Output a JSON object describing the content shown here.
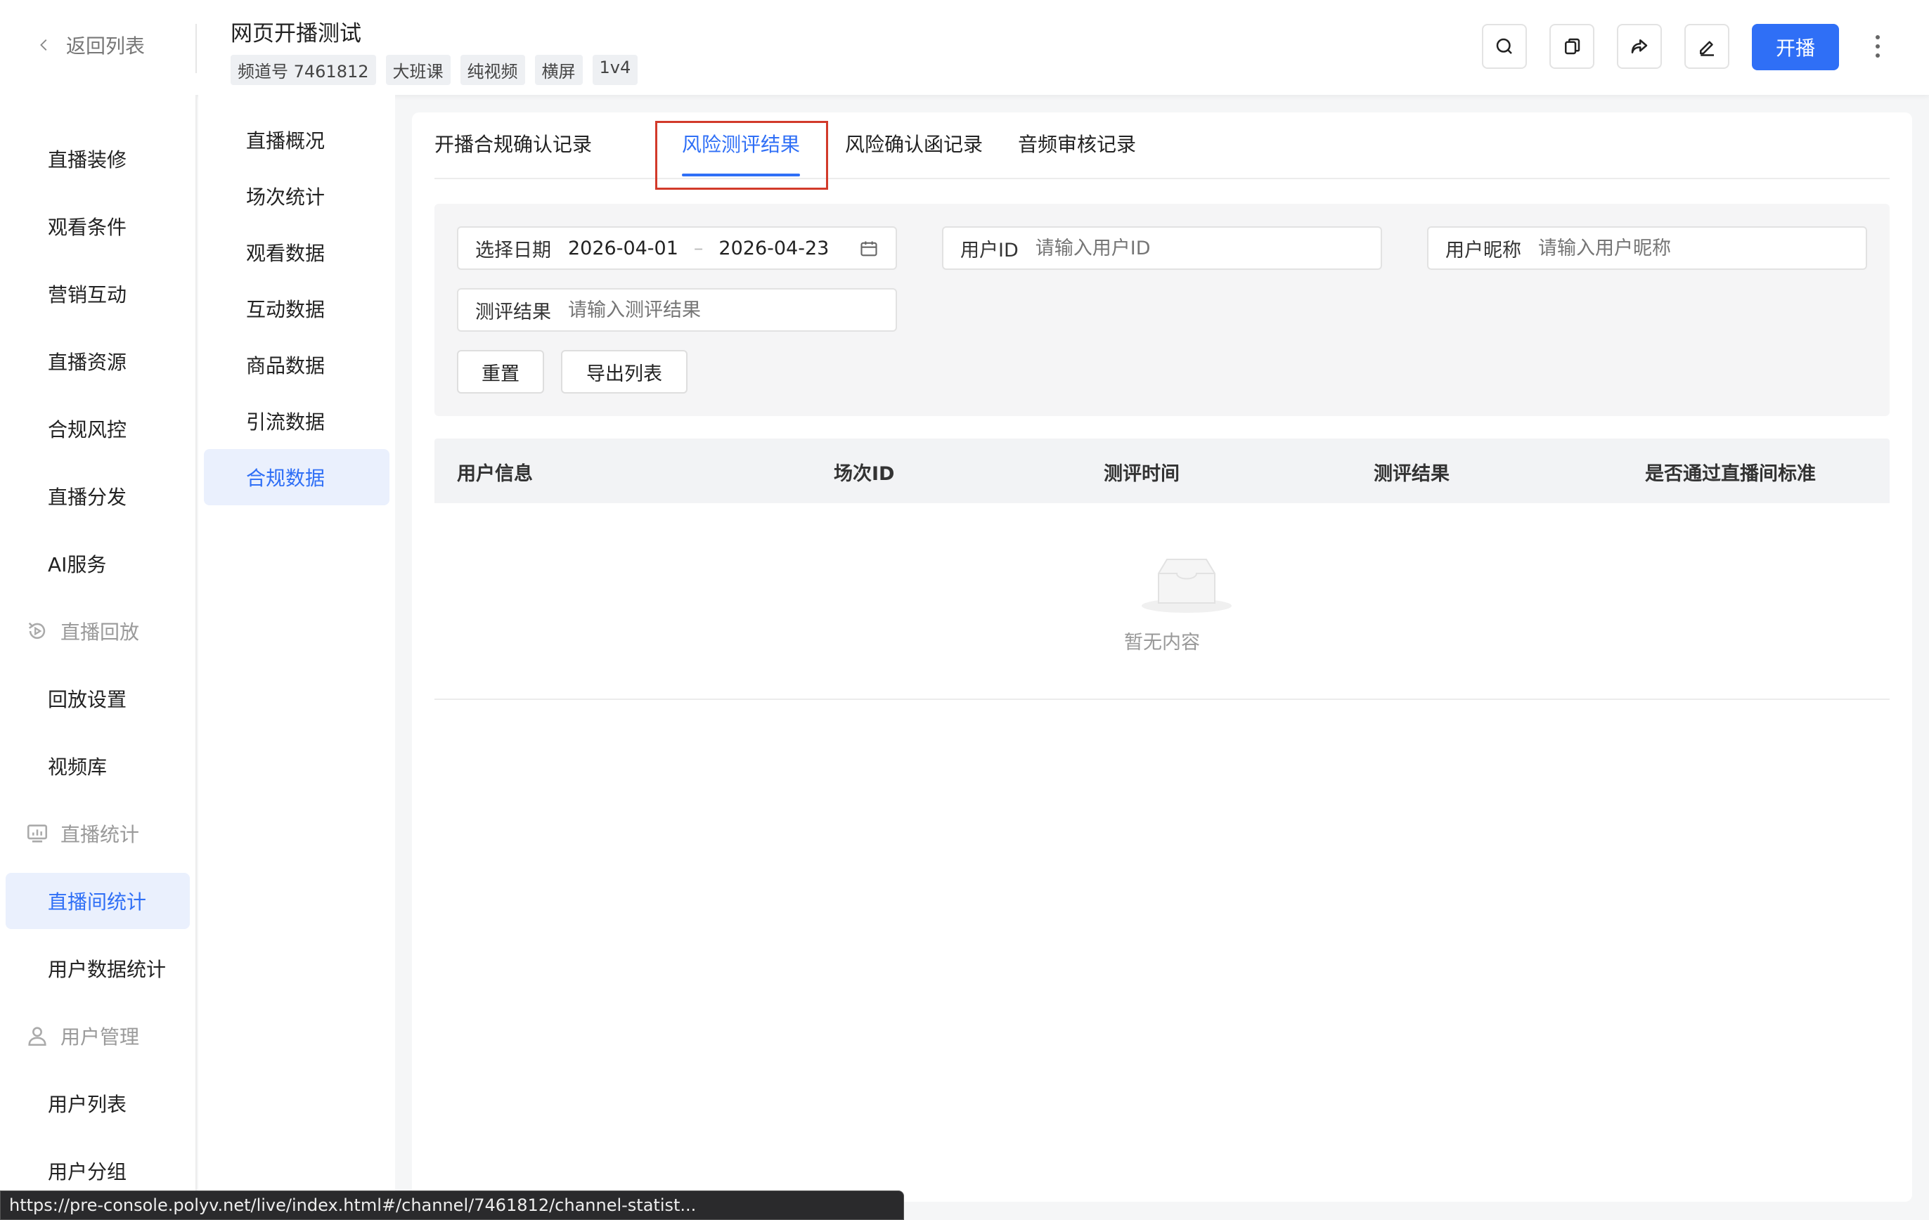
{
  "header": {
    "back_label": "返回列表",
    "title": "网页开播测试",
    "tags": [
      "频道号 7461812",
      "大班课",
      "纯视频",
      "横屏",
      "1v4"
    ],
    "start_label": "开播",
    "icons": [
      "search-icon",
      "copy-icon",
      "share-icon",
      "edit-icon",
      "more-icon"
    ]
  },
  "sidebar": {
    "items": [
      {
        "label": "直播装修",
        "type": "item"
      },
      {
        "label": "观看条件",
        "type": "item"
      },
      {
        "label": "营销互动",
        "type": "item"
      },
      {
        "label": "直播资源",
        "type": "item"
      },
      {
        "label": "合规风控",
        "type": "item"
      },
      {
        "label": "直播分发",
        "type": "item"
      },
      {
        "label": "AI服务",
        "type": "item"
      },
      {
        "label": "直播回放",
        "type": "group",
        "icon": "replay-icon"
      },
      {
        "label": "回放设置",
        "type": "item"
      },
      {
        "label": "视频库",
        "type": "item"
      },
      {
        "label": "直播统计",
        "type": "group",
        "icon": "stats-icon"
      },
      {
        "label": "直播间统计",
        "type": "item",
        "active": true
      },
      {
        "label": "用户数据统计",
        "type": "item"
      },
      {
        "label": "用户管理",
        "type": "group",
        "icon": "user-icon"
      },
      {
        "label": "用户列表",
        "type": "item"
      },
      {
        "label": "用户分组",
        "type": "item"
      }
    ]
  },
  "subnav": {
    "items": [
      "直播概况",
      "场次统计",
      "观看数据",
      "互动数据",
      "商品数据",
      "引流数据",
      "合规数据"
    ],
    "active": "合规数据"
  },
  "tabs": {
    "items": [
      "开播合规确认记录",
      "风险测评结果",
      "风险确认函记录",
      "音频审核记录"
    ],
    "active": "风险测评结果"
  },
  "filter": {
    "date_label": "选择日期",
    "date_start": "2026-04-01",
    "date_sep": "–",
    "date_end": "2026-04-23",
    "user_id_label": "用户ID",
    "user_id_placeholder": "请输入用户ID",
    "nickname_label": "用户昵称",
    "nickname_placeholder": "请输入用户昵称",
    "result_label": "测评结果",
    "result_placeholder": "请输入测评结果",
    "reset_label": "重置",
    "export_label": "导出列表"
  },
  "table": {
    "columns": [
      "用户信息",
      "场次ID",
      "测评时间",
      "测评结果",
      "是否通过直播间标准"
    ],
    "rows": [],
    "empty_text": "暂无内容"
  },
  "status_bar": {
    "url": "https://pre-console.polyv.net/live/index.html#/channel/7461812/channel-statist..."
  },
  "colors": {
    "accent": "#2f6ff6",
    "highlight_box": "#d23a2a"
  }
}
